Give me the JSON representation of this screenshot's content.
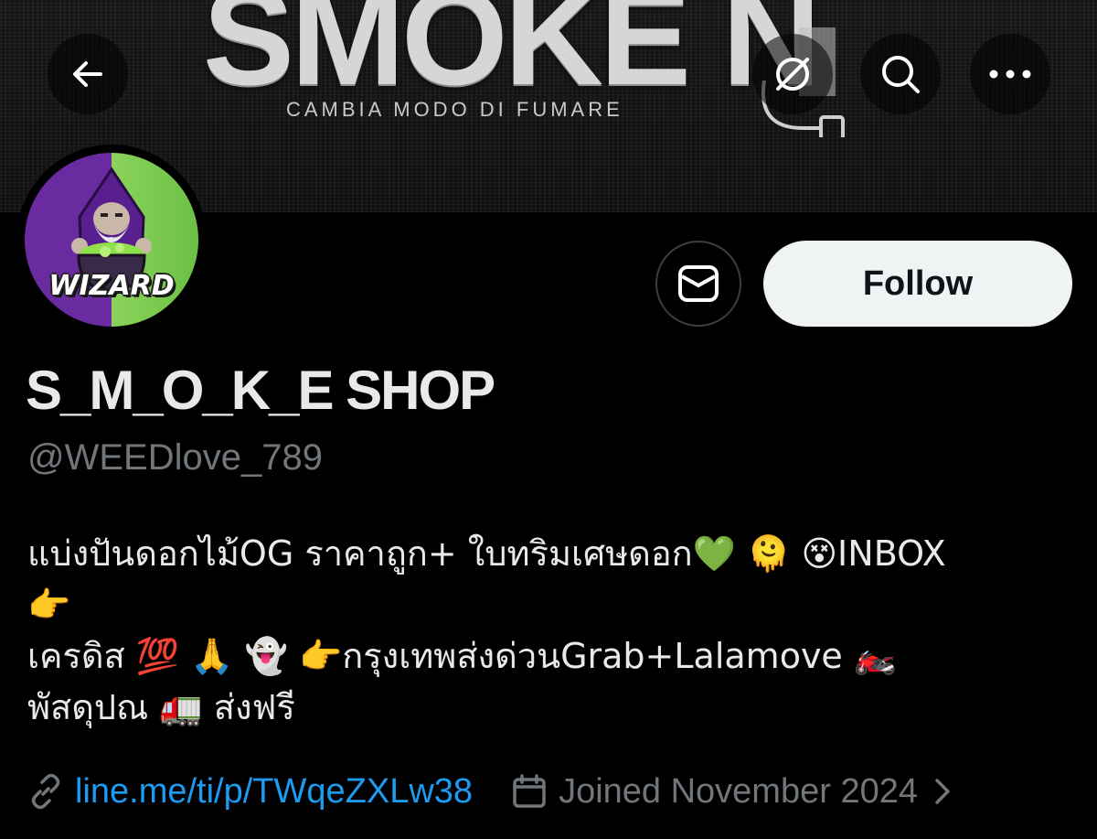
{
  "banner": {
    "logo_text": "SMOKE N",
    "tagline": "CAMBIA MODO DI FUMARE"
  },
  "nav": {
    "back_icon": "arrow-left-icon",
    "grok_icon": "grok-icon",
    "search_icon": "search-icon",
    "more_icon": "more-horizontal-icon"
  },
  "avatar": {
    "label": "WIZARD"
  },
  "actions": {
    "message_icon": "envelope-icon",
    "follow_label": "Follow"
  },
  "profile": {
    "display_name": "S_M_O_K_E SHOP",
    "handle": "@WEEDlove_789",
    "bio_lines": [
      "แบ่งปันดอกไม้OG ราคาถูก+ ใบทริมเศษดอก💚 🫠 😵INBOX",
      "👉",
      "เครดิส 💯 🙏 👻 👉กรุงเทพส่งด่วนGrab+Lalamove 🏍️",
      "พัสดุปณ 🚛 ส่งฟรี"
    ],
    "link": "line.me/ti/p/TWqeZXLw38",
    "joined": "Joined November 2024"
  },
  "colors": {
    "background": "#000000",
    "text_primary": "#e7e9ea",
    "text_secondary": "#71767b",
    "link": "#1d9bf0",
    "follow_bg": "#eff3f4"
  }
}
